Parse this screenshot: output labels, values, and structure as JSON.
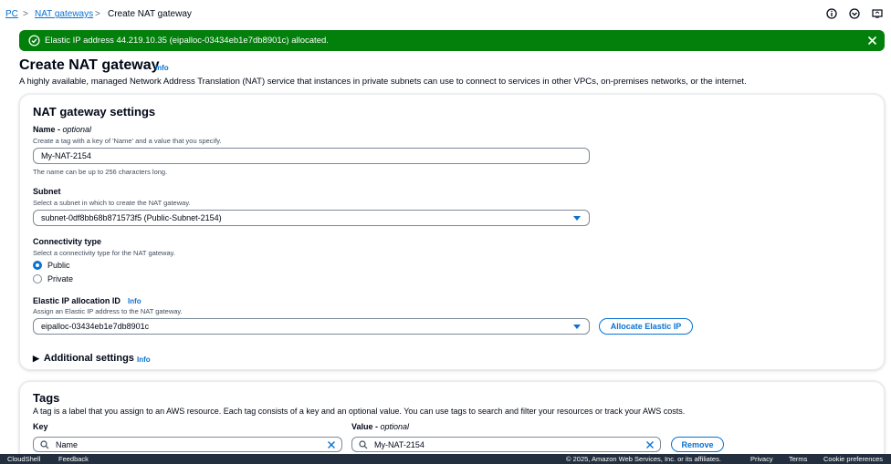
{
  "breadcrumb": {
    "parent_label": "PC",
    "middle_label": "NAT gateways",
    "current_label": "Create NAT gateway",
    "separator": ">"
  },
  "flash": {
    "message": "Elastic IP address 44.219.10.35 (eipalloc-03434eb1e7db8901c) allocated.",
    "color": "#037f0c"
  },
  "header": {
    "title": "Create NAT gateway",
    "info_label": "Info",
    "description": "A highly available, managed Network Address Translation (NAT) service that instances in private subnets can use to connect to services in other VPCs, on-premises networks, or the internet."
  },
  "settings": {
    "title": "NAT gateway settings",
    "name": {
      "label": "Name",
      "optional": "optional",
      "description": "Create a tag with a key of 'Name' and a value that you specify.",
      "value": "My-NAT-2154",
      "constraint": "The name can be up to 256 characters long."
    },
    "subnet": {
      "label": "Subnet",
      "description": "Select a subnet in which to create the NAT gateway.",
      "value": "subnet-0df8bb68b871573f5 (Public-Subnet-2154)"
    },
    "connectivity": {
      "label": "Connectivity type",
      "description": "Select a connectivity type for the NAT gateway.",
      "options": [
        "Public",
        "Private"
      ],
      "selected": "Public"
    },
    "eip": {
      "label": "Elastic IP allocation ID",
      "info_label": "Info",
      "description": "Assign an Elastic IP address to the NAT gateway.",
      "value": "eipalloc-03434eb1e7db8901c",
      "button_label": "Allocate Elastic IP"
    },
    "additional": {
      "label": "Additional settings",
      "info_label": "Info"
    }
  },
  "tags": {
    "title": "Tags",
    "description": "A tag is a label that you assign to an AWS resource. Each tag consists of a key and an optional value. You can use tags to search and filter your resources or track your AWS costs.",
    "key_label": "Key",
    "value_label": "Value",
    "value_optional": "optional",
    "rows": [
      {
        "key": "Name",
        "value": "My-NAT-2154"
      }
    ],
    "remove_label": "Remove"
  },
  "footer": {
    "cloudshell": "CloudShell",
    "feedback": "Feedback",
    "copyright": "© 2025, Amazon Web Services, Inc. or its affiliates.",
    "privacy": "Privacy",
    "terms": "Terms",
    "cookies": "Cookie preferences"
  },
  "icons": {
    "top": [
      "info-icon",
      "notifications-icon",
      "settings-icon"
    ],
    "flash": "success-check-icon",
    "close": "close-icon",
    "search": "search-icon",
    "clear": "clear-x-icon"
  },
  "colors": {
    "accent": "#0972d3",
    "success": "#037f0c",
    "footer": "#232f3e"
  }
}
